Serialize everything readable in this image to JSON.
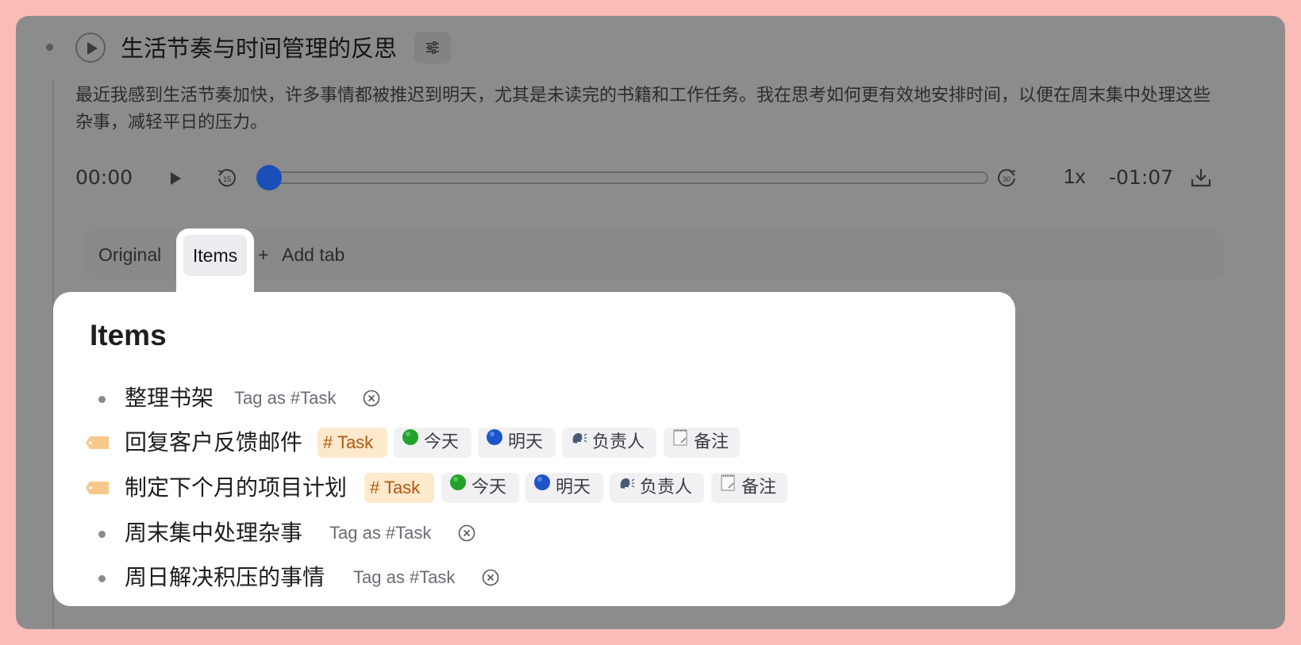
{
  "note": {
    "title": "生活节奏与时间管理的反思",
    "body": "最近我感到生活节奏加快，许多事情都被推迟到明天，尤其是未读完的书籍和工作任务。我在思考如何更有效地安排时间，以便在周末集中处理这些杂事，减轻平日的压力。"
  },
  "player": {
    "current_time": "00:00",
    "remaining_time": "-01:07",
    "speed": "1x",
    "progress": 0.0,
    "skip_back_label": "15",
    "skip_forward_label": "30"
  },
  "tabs": {
    "original": "Original",
    "items": "Items",
    "add_tab": "Add tab",
    "add_symbol": "+"
  },
  "items_panel": {
    "title": "Items",
    "tag_as_label": "Tag as #Task",
    "task_label": "# Task",
    "chips": {
      "today": "今天",
      "tomorrow": "明天",
      "assignee": "负责人",
      "notes": "备注"
    },
    "items": [
      {
        "text": "整理书架",
        "tagged": false
      },
      {
        "text": "回复客户反馈邮件",
        "tagged": true
      },
      {
        "text": "制定下个月的项目计划",
        "tagged": true
      },
      {
        "text": "周末集中处理杂事",
        "tagged": false
      },
      {
        "text": "周日解决积压的事情",
        "tagged": false
      }
    ]
  },
  "colors": {
    "page_bg": "#fbbcb8",
    "overlay": "#8c8c8c",
    "accent_blue": "#1a4fb8",
    "task_chip_bg": "#fde9cc",
    "task_chip_text": "#b4560e"
  }
}
